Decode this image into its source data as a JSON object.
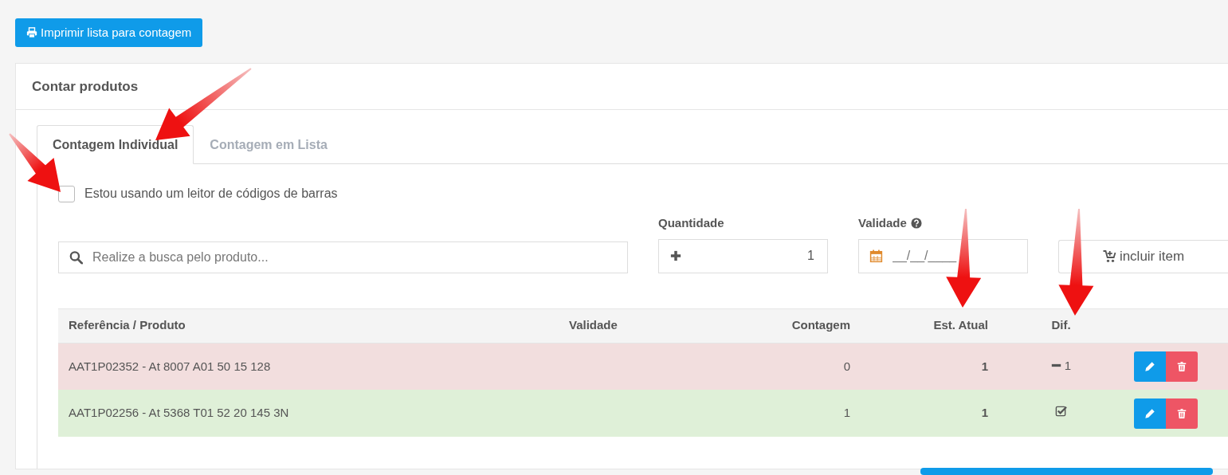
{
  "print_button": {
    "label": "Imprimir lista para contagem"
  },
  "card": {
    "title": "Contar produtos"
  },
  "tabs": [
    {
      "label": "Contagem Individual",
      "selected": true
    },
    {
      "label": "Contagem em Lista",
      "selected": false
    }
  ],
  "barcode_option": {
    "label": "Estou usando um leitor de códigos de barras",
    "checked": false
  },
  "search": {
    "placeholder": "Realize a busca pelo produto..."
  },
  "quantity": {
    "label": "Quantidade",
    "value": "1"
  },
  "validity": {
    "label": "Validade",
    "placeholder": "__/__/____"
  },
  "add_button": {
    "label": "incluir item"
  },
  "table": {
    "columns": [
      "Referência / Produto",
      "Validade",
      "Contagem",
      "Est. Atual",
      "Dif."
    ],
    "rows": [
      {
        "matches": false,
        "product": "AAT1P02352 - At 8007 A01 50 15 128",
        "count": "0",
        "stock": "1",
        "diff": {
          "kind": "minus",
          "text": "1"
        }
      },
      {
        "matches": true,
        "product": "AAT1P02256 - At 5368 T01 52 20 145 3N",
        "count": "1",
        "stock": "1",
        "diff": {
          "kind": "ok"
        }
      }
    ]
  }
}
